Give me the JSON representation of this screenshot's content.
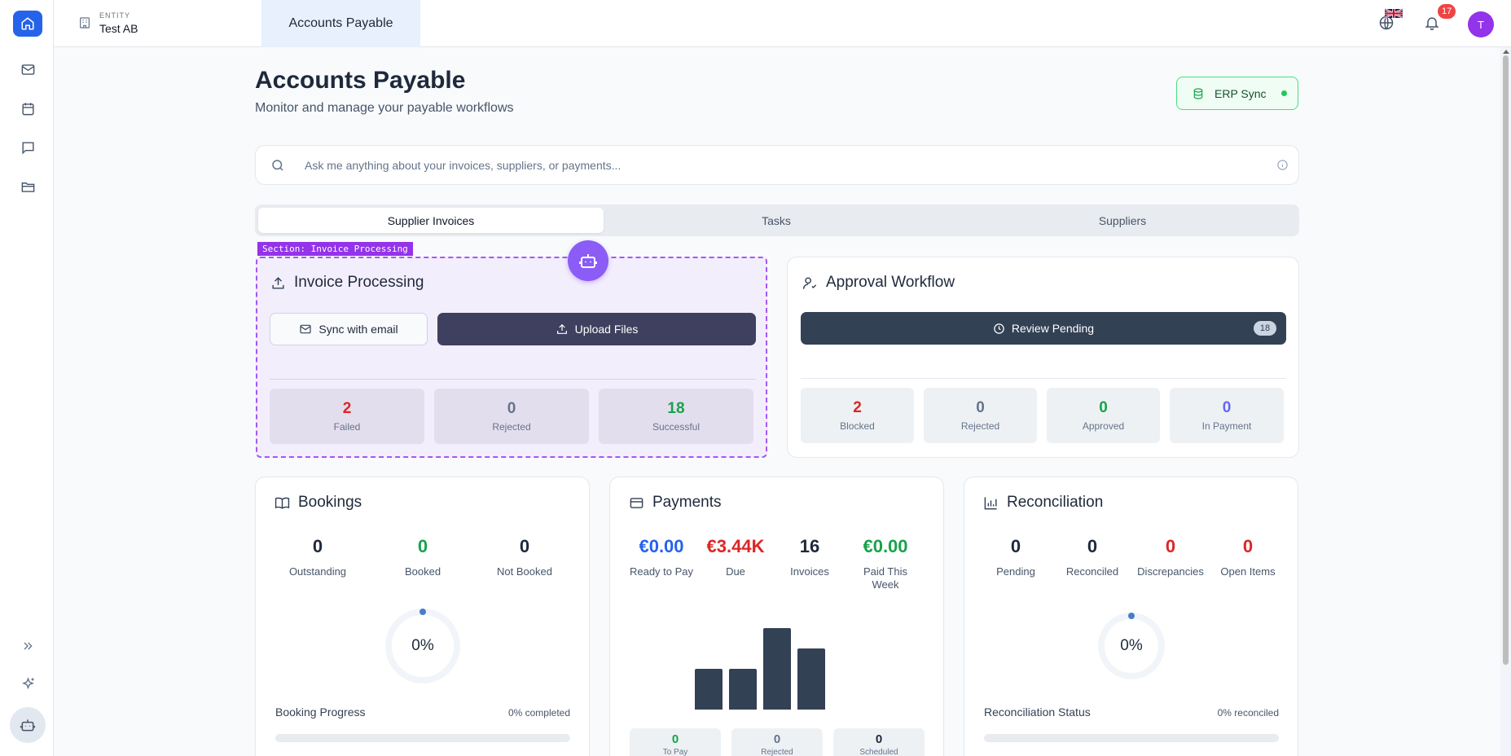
{
  "colors": {
    "accent": "#2563eb",
    "robot": "#8b5cf6",
    "danger": "#dc2626",
    "success": "#16a34a",
    "dark_button": "#334155"
  },
  "topbar": {
    "entity_label": "ENTITY",
    "entity_value": "Test AB",
    "active_tab": "Accounts Payable",
    "notification_count": "17",
    "avatar_initial": "T"
  },
  "header": {
    "title": "Accounts Payable",
    "subtitle": "Monitor and manage your payable workflows",
    "erp_label": "ERP Sync"
  },
  "search": {
    "placeholder": "Ask me anything about your invoices, suppliers, or payments...",
    "value": ""
  },
  "tabs": [
    "Supplier Invoices",
    "Tasks",
    "Suppliers"
  ],
  "invoice_processing": {
    "section_tag": "Section: Invoice Processing",
    "title": "Invoice Processing",
    "sync_label": "Sync with email",
    "upload_label": "Upload Files",
    "stats": [
      {
        "value": "2",
        "label": "Failed"
      },
      {
        "value": "0",
        "label": "Rejected"
      },
      {
        "value": "18",
        "label": "Successful"
      }
    ]
  },
  "approval": {
    "title": "Approval Workflow",
    "review_label": "Review Pending",
    "review_count": "18",
    "stats": [
      {
        "value": "2",
        "label": "Blocked"
      },
      {
        "value": "0",
        "label": "Rejected"
      },
      {
        "value": "0",
        "label": "Approved"
      },
      {
        "value": "0",
        "label": "In Payment"
      }
    ]
  },
  "bookings": {
    "title": "Bookings",
    "metrics": [
      {
        "value": "0",
        "label": "Outstanding"
      },
      {
        "value": "0",
        "label": "Booked"
      },
      {
        "value": "0",
        "label": "Not Booked"
      }
    ],
    "ring_pct": "0%",
    "progress_label": "Booking Progress",
    "progress_text": "0% completed",
    "progress_value": 0
  },
  "payments": {
    "title": "Payments",
    "metrics": [
      {
        "value": "€0.00",
        "label": "Ready to Pay"
      },
      {
        "value": "€3.44K",
        "label": "Due"
      },
      {
        "value": "16",
        "label": "Invoices"
      },
      {
        "value": "€0.00",
        "label": "Paid This Week"
      }
    ],
    "chart_data": {
      "type": "bar",
      "categories": [
        "1",
        "2",
        "3",
        "4"
      ],
      "values": [
        50,
        50,
        100,
        75
      ],
      "ylim": [
        0,
        100
      ]
    },
    "mini": [
      {
        "value": "0",
        "label": "To Pay"
      },
      {
        "value": "0",
        "label": "Rejected"
      },
      {
        "value": "0",
        "label": "Scheduled"
      }
    ]
  },
  "reconciliation": {
    "title": "Reconciliation",
    "metrics": [
      {
        "value": "0",
        "label": "Pending"
      },
      {
        "value": "0",
        "label": "Reconciled"
      },
      {
        "value": "0",
        "label": "Discrepancies"
      },
      {
        "value": "0",
        "label": "Open Items"
      }
    ],
    "ring_pct": "0%",
    "progress_label": "Reconciliation Status",
    "progress_text": "0% reconciled",
    "progress_value": 0
  },
  "icons": [
    "home-icon",
    "mail-icon",
    "calendar-icon",
    "message-icon",
    "folder-icon",
    "expand-icon",
    "sparkle-icon",
    "robot-icon",
    "building-icon",
    "chevron-right-icon",
    "globe-icon",
    "bell-icon",
    "database-icon",
    "search-icon",
    "info-icon",
    "upload-icon",
    "mail-sync-icon",
    "user-check-icon",
    "clock-icon",
    "book-icon",
    "card-icon",
    "bar-chart-icon"
  ]
}
